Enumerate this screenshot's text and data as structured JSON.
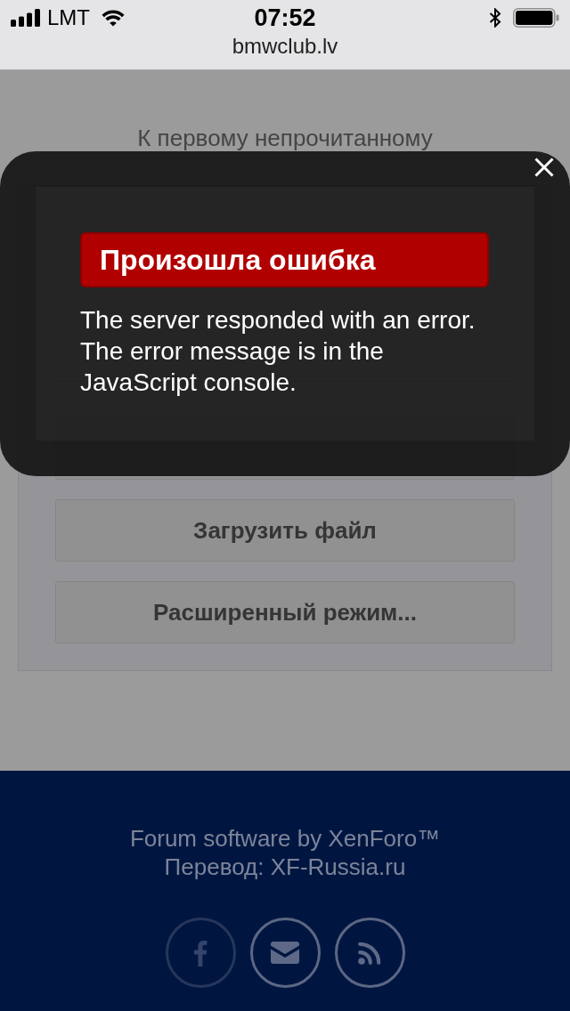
{
  "status_bar": {
    "carrier": "LMT",
    "time": "07:52"
  },
  "address_bar": {
    "url": "bmwclub.lv"
  },
  "thread": {
    "jump_link": "К первому непрочитанному",
    "reply_panel": {
      "upload_button": "Загрузить файл",
      "advanced_button": "Расширенный режим..."
    }
  },
  "error_dialog": {
    "title": "Произошла ошибка",
    "message": "The server responded with an error. The error message is in the JavaScript console."
  },
  "footer": {
    "credit": "Forum software by XenForo™",
    "translation": "Перевод: XF-Russia.ru",
    "social_links": [
      {
        "kind": "facebook",
        "dimmed": true
      },
      {
        "kind": "email",
        "dimmed": false
      },
      {
        "kind": "rss",
        "dimmed": false
      }
    ]
  }
}
